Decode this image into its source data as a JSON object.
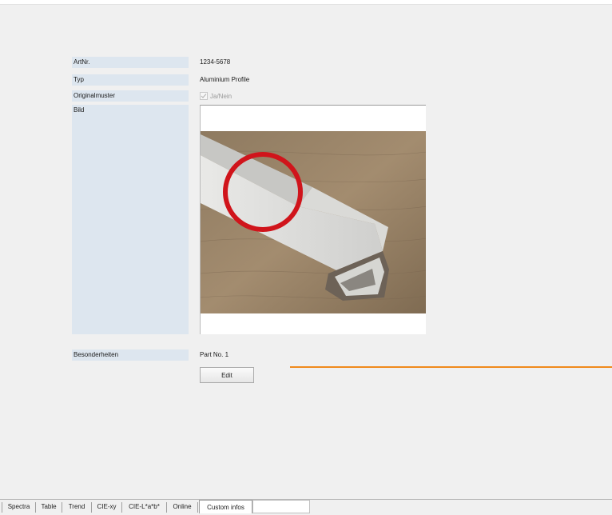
{
  "fields": {
    "artnr": {
      "label": "ArtNr.",
      "value": "1234-5678"
    },
    "typ": {
      "label": "Typ",
      "value": "Aluminium Profile"
    },
    "originalmuster": {
      "label": "Originalmuster",
      "checkbox_label": "Ja/Nein",
      "checked": true
    },
    "bild": {
      "label": "Bild"
    },
    "besonderheiten": {
      "label": "Besonderheiten",
      "value": "Part No. 1"
    }
  },
  "buttons": {
    "edit": "Edit"
  },
  "tabs": [
    {
      "label": "Spectra"
    },
    {
      "label": "Table"
    },
    {
      "label": "Trend"
    },
    {
      "label": "CIE-xy"
    },
    {
      "label": "CIE-L*a*b*"
    },
    {
      "label": "Online"
    },
    {
      "label": "Custom infos",
      "active": true
    }
  ],
  "colors": {
    "label_bg": "#dde6ef",
    "highlight_circle": "#d0141b",
    "orange_line": "#f08a1c"
  }
}
